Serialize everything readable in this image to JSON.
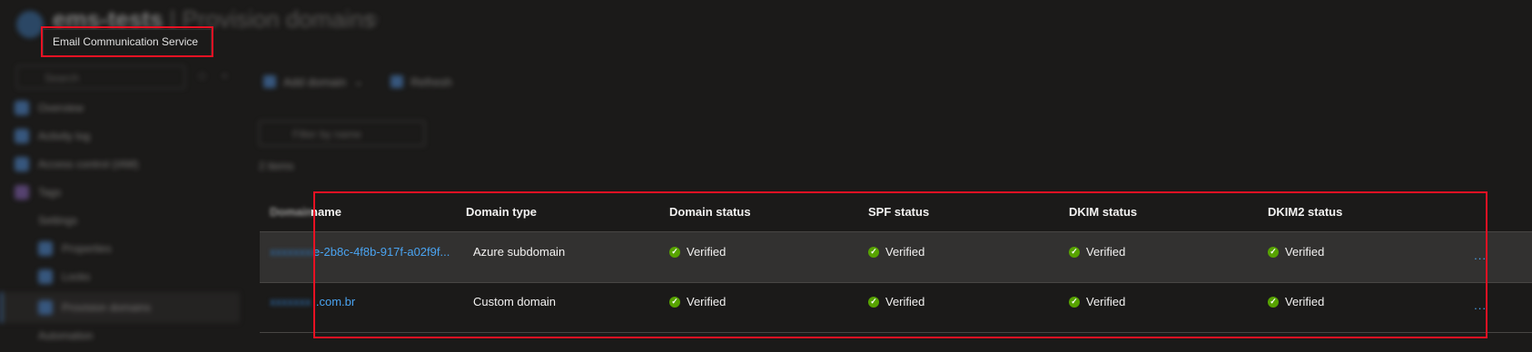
{
  "header": {
    "title": "ems-tests",
    "subtitle": " | Provision domains",
    "tooltip": "Email Communication Service"
  },
  "sidebar": {
    "search_placeholder": "Search",
    "items": [
      {
        "label": "Overview"
      },
      {
        "label": "Activity log"
      },
      {
        "label": "Access control (IAM)"
      },
      {
        "label": "Tags"
      },
      {
        "label": "Settings"
      },
      {
        "label": "Properties"
      },
      {
        "label": "Locks"
      },
      {
        "label": "Provision domains"
      },
      {
        "label": "Automation"
      }
    ]
  },
  "toolbar": {
    "add_domain": "Add domain",
    "refresh": "Refresh",
    "filter_placeholder": "Filter by name",
    "count_text": "2 items"
  },
  "table": {
    "columns": [
      "name",
      "Domain type",
      "Domain status",
      "SPF status",
      "DKIM status",
      "DKIM2 status"
    ],
    "name_header_prefix": "Domain ",
    "rows": [
      {
        "name_hidden": "xxxxxxxx-",
        "name": "e-2b8c-4f8b-917f-a02f9f...",
        "domain_type": "Azure subdomain",
        "domain_status": "Verified",
        "spf_status": "Verified",
        "dkim_status": "Verified",
        "dkim2_status": "Verified",
        "more": "..."
      },
      {
        "name_hidden": "xxxxxxx",
        "name": "i.com.br",
        "domain_type": "Custom domain",
        "domain_status": "Verified",
        "spf_status": "Verified",
        "dkim_status": "Verified",
        "dkim2_status": "Verified",
        "more": "..."
      }
    ]
  },
  "colors": {
    "background": "#1b1a19",
    "link": "#4aa3f0",
    "verified": "#57a300",
    "highlight_outline": "#e81123"
  }
}
